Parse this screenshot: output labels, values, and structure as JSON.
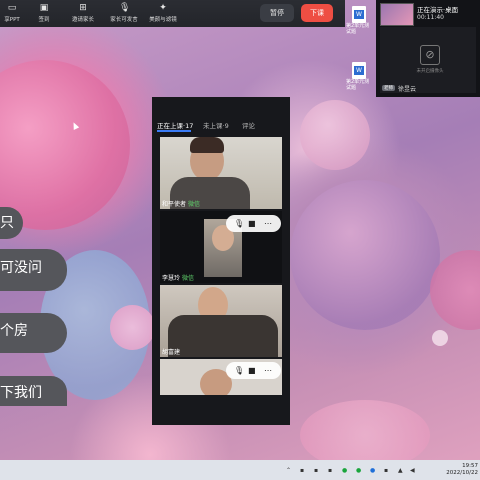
{
  "toolbar": {
    "items": [
      {
        "label": "享PPT",
        "icon": "slides-icon"
      },
      {
        "label": "签到",
        "icon": "checkin-icon"
      },
      {
        "label": "邀请家长",
        "icon": "invite-icon"
      },
      {
        "label": "家长可发言",
        "icon": "mic-icon"
      },
      {
        "label": "美颜与滤镜",
        "icon": "beauty-icon"
      }
    ],
    "pause_label": "暂停",
    "end_label": "下课"
  },
  "desktop_icons": [
    {
      "label": "第2单元测试题",
      "icon": "word-doc-icon"
    },
    {
      "label": "第2单元测试题",
      "icon": "word-doc-icon"
    }
  ],
  "share_preview": {
    "title": "正在演示·桌面",
    "timer": "00:11:40",
    "camera_status": "未开启摄像头",
    "host_tag": "老师",
    "host_name": "徐昱云"
  },
  "participants_panel": {
    "tabs": [
      {
        "label": "正在上课·17",
        "active": true
      },
      {
        "label": "未上课·9",
        "active": false
      },
      {
        "label": "评论",
        "active": false
      }
    ],
    "participants": [
      {
        "name": "和平使者",
        "tag": "微信"
      },
      {
        "name": "李慧玲",
        "tag": "微信"
      },
      {
        "name": "胡富建",
        "tag": ""
      },
      {
        "name": "",
        "tag": ""
      }
    ]
  },
  "chat_bubbles": [
    {
      "text": "只"
    },
    {
      "text": "可没问"
    },
    {
      "text": "个房"
    },
    {
      "text": "下我们"
    }
  ],
  "taskbar": {
    "time": "19:57",
    "date": "2022/10/22"
  },
  "colors": {
    "end_button": "#ee4e43",
    "active_tab_underline": "#3b7cf6",
    "wechat_tag": "#5fd16b"
  }
}
